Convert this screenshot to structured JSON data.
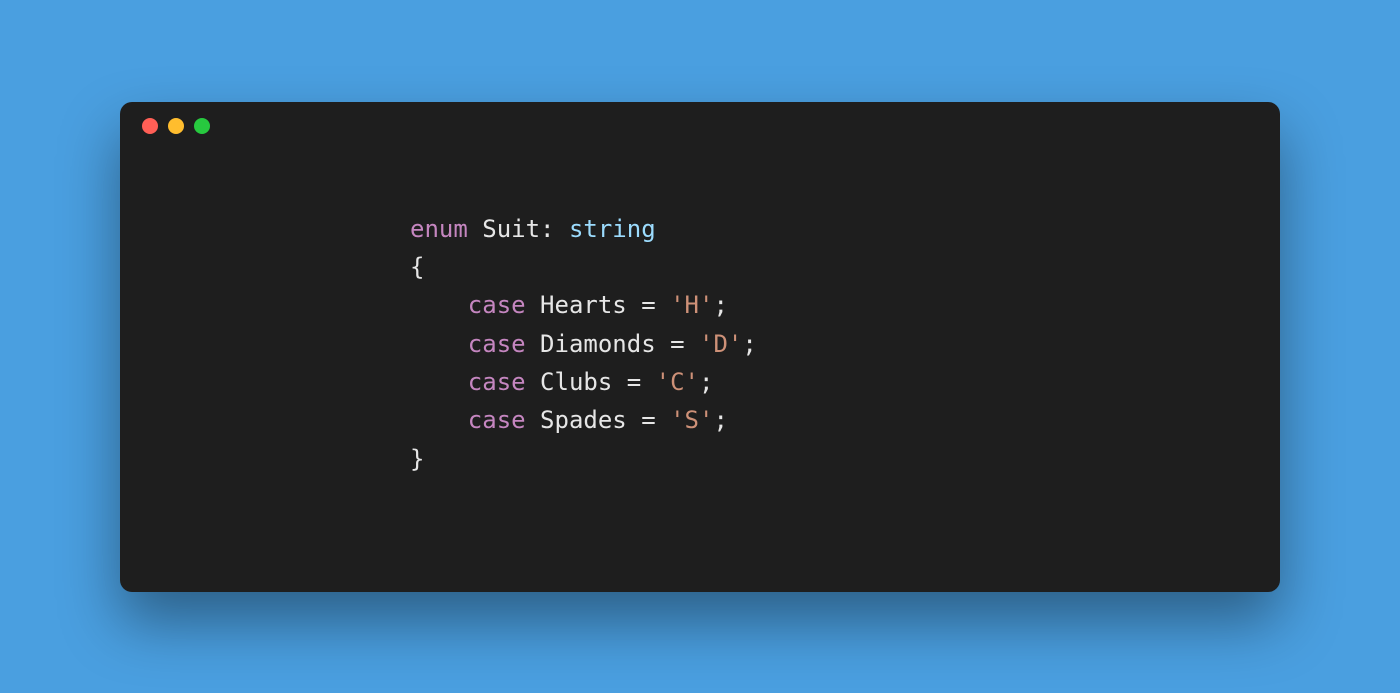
{
  "code": {
    "line1": {
      "keyword": "enum",
      "name": "Suit",
      "colon": ":",
      "type": "string"
    },
    "line2": {
      "brace": "{"
    },
    "cases": [
      {
        "keyword": "case",
        "name": "Hearts",
        "eq": "=",
        "value": "'H'",
        "semi": ";"
      },
      {
        "keyword": "case",
        "name": "Diamonds",
        "eq": "=",
        "value": "'D'",
        "semi": ";"
      },
      {
        "keyword": "case",
        "name": "Clubs",
        "eq": "=",
        "value": "'C'",
        "semi": ";"
      },
      {
        "keyword": "case",
        "name": "Spades",
        "eq": "=",
        "value": "'S'",
        "semi": ";"
      }
    ],
    "line7": {
      "brace": "}"
    }
  }
}
